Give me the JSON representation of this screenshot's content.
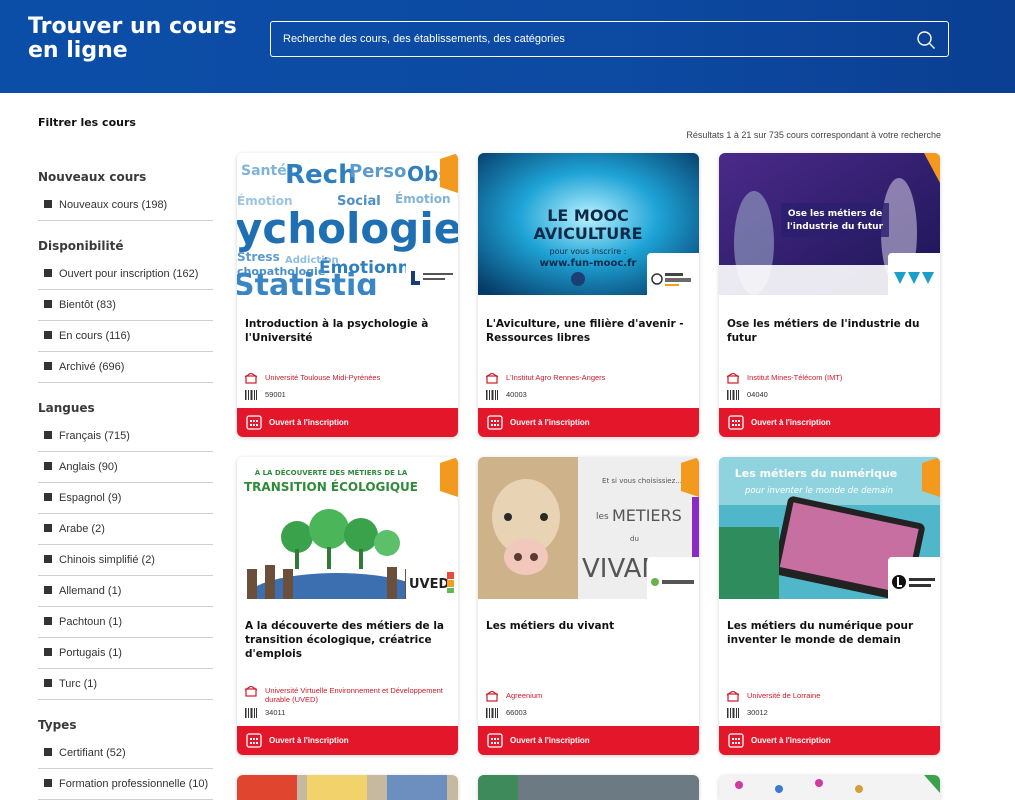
{
  "header": {
    "title": "Trouver un cours en ligne",
    "search_placeholder": "Recherche des cours, des établissements, des catégories"
  },
  "filter_title": "Filtrer les cours",
  "results_text": "Résultats 1 à 21 sur 735 cours correspondant à votre recherche",
  "filters": [
    {
      "title": "Nouveaux cours",
      "items": [
        "Nouveaux cours (198)"
      ]
    },
    {
      "title": "Disponibilité",
      "items": [
        "Ouvert pour inscription (162)",
        "Bientôt (83)",
        "En cours (116)",
        "Archivé (696)"
      ]
    },
    {
      "title": "Langues",
      "items": [
        "Français (715)",
        "Anglais (90)",
        "Espagnol (9)",
        "Arabe (2)",
        "Chinois simplifié (2)",
        "Allemand (1)",
        "Pachtoun (1)",
        "Portugais (1)",
        "Turc (1)"
      ]
    },
    {
      "title": "Types",
      "items": [
        "Certifiant (52)",
        "Formation professionnelle (10)"
      ]
    }
  ],
  "cards": [
    {
      "title": "Introduction à la psychologie à l'Université",
      "org": "Université Toulouse Midi-Pyrénées",
      "code": "59001",
      "status": "Ouvert à l'inscription",
      "logo": "Université de Toulouse",
      "image": "psychologie"
    },
    {
      "title": "L'Aviculture, une filière d'avenir - Ressources libres",
      "org": "L'Institut Agro Rennes-Angers",
      "code": "40003",
      "status": "Ouvert à l'inscription",
      "logo": "agro",
      "image": "aviculture"
    },
    {
      "title": "Ose les métiers de l'industrie du futur",
      "org": "Institut Mines-Télécom (IMT)",
      "code": "04040",
      "status": "Ouvert à l'inscription",
      "logo": "IMT",
      "image": "industrie"
    },
    {
      "title": "A la découverte des métiers de la transition écologique, créatrice d'emplois",
      "org": "Université Virtuelle Environnement et Développement durable (UVED)",
      "code": "34011",
      "status": "Ouvert à l'inscription",
      "logo": "UVED",
      "image": "transition"
    },
    {
      "title": "Les métiers du vivant",
      "org": "Agreenium",
      "code": "66003",
      "status": "Ouvert à l'inscription",
      "logo": "agreenium",
      "image": "vivant"
    },
    {
      "title": "Les métiers du numérique pour inventer le monde de demain",
      "org": "Université de Lorraine",
      "code": "30012",
      "status": "Ouvert à l'inscription",
      "logo": "Université de Lorraine",
      "image": "numerique"
    }
  ],
  "image_text": {
    "aviculture_1": "LE MOOC",
    "aviculture_2": "AVICULTURE",
    "aviculture_3": "pour vous inscrire :",
    "aviculture_4": "www.fun-mooc.fr",
    "industrie_1": "Ose les métiers de",
    "industrie_2": "l'industrie du futur",
    "transition_1": "À LA DÉCOUVERTE DES MÉTIERS DE LA",
    "transition_2": "TRANSITION ÉCOLOGIQUE",
    "vivant_1": "Et si vous choisissiez...",
    "vivant_2": "les",
    "vivant_3": "METIERS",
    "vivant_4": "du",
    "vivant_5": "VIVANT",
    "numerique_1": "Les métiers du numérique",
    "numerique_2": "pour inventer le monde de demain"
  },
  "colors": {
    "header": "#0b4ea8",
    "status": "#e4172a",
    "org": "#d0192a",
    "accent_arrow": "#f39a1e"
  }
}
